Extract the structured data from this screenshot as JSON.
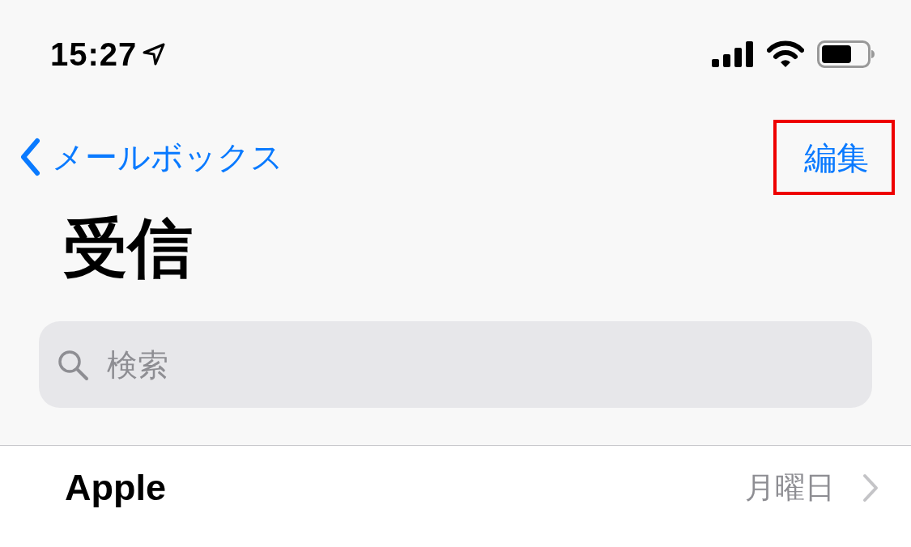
{
  "status_bar": {
    "time": "15:27"
  },
  "nav": {
    "back_label": "メールボックス",
    "edit": {
      "label": "編集",
      "highlighted": true
    }
  },
  "title": "受信",
  "search": {
    "placeholder": "検索"
  },
  "messages": [
    {
      "sender": "Apple",
      "date": "月曜日"
    }
  ]
}
